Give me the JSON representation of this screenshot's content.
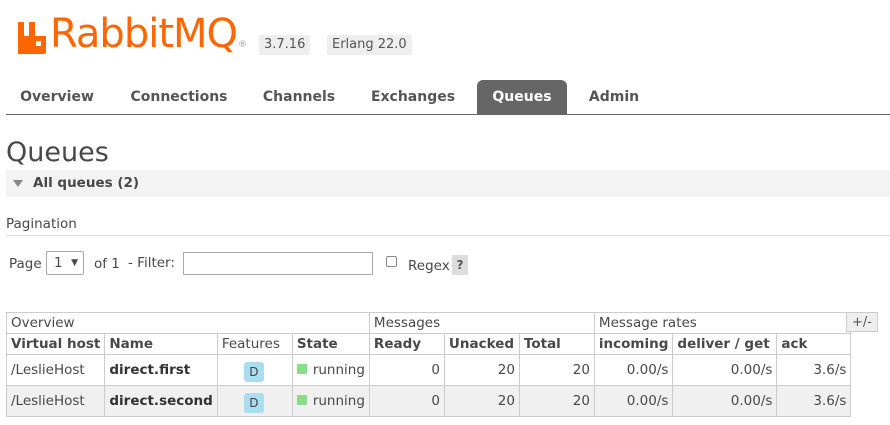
{
  "header": {
    "logo_text_rabbit": "Rabbit",
    "logo_text_mq": "MQ",
    "logo_tm": "®",
    "version": "3.7.16",
    "erlang": "Erlang 22.0"
  },
  "nav": {
    "tabs": [
      {
        "label": "Overview"
      },
      {
        "label": "Connections"
      },
      {
        "label": "Channels"
      },
      {
        "label": "Exchanges"
      },
      {
        "label": "Queues",
        "active": true
      },
      {
        "label": "Admin"
      }
    ]
  },
  "page": {
    "title": "Queues",
    "section_label": "All queues (2)",
    "pagination_title": "Pagination"
  },
  "controls": {
    "page_label": "Page",
    "page_value": "1",
    "of_label": "of 1",
    "filter_label": "- Filter:",
    "filter_value": "",
    "regex_label": "Regex",
    "help_label": "?"
  },
  "table": {
    "groups": [
      "Overview",
      "Messages",
      "Message rates"
    ],
    "columns": [
      "Virtual host",
      "Name",
      "Features",
      "State",
      "Ready",
      "Unacked",
      "Total",
      "incoming",
      "deliver / get",
      "ack"
    ],
    "plusminus": "+/-",
    "rows": [
      {
        "vhost": "/LeslieHost",
        "name": "direct.first",
        "feature": "D",
        "state": "running",
        "ready": "0",
        "unacked": "20",
        "total": "20",
        "incoming": "0.00/s",
        "deliver": "0.00/s",
        "ack": "3.6/s"
      },
      {
        "vhost": "/LeslieHost",
        "name": "direct.second",
        "feature": "D",
        "state": "running",
        "ready": "0",
        "unacked": "20",
        "total": "20",
        "incoming": "0.00/s",
        "deliver": "0.00/s",
        "ack": "3.6/s"
      }
    ]
  },
  "colors": {
    "brand": "#ff6600",
    "active_tab": "#666666",
    "running": "#88dd88",
    "durable_badge": "#aaddf0"
  }
}
